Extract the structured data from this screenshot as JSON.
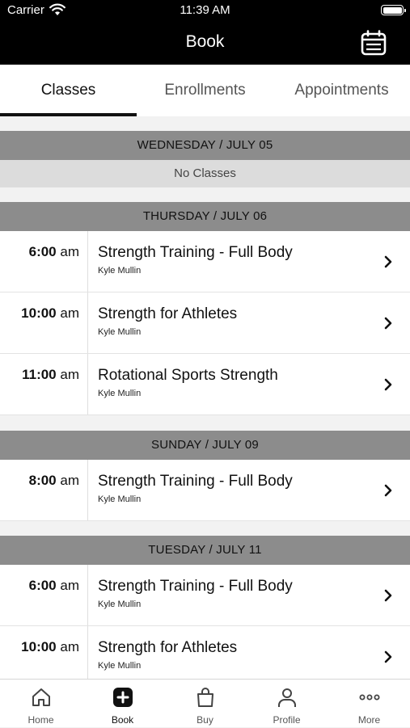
{
  "status_bar": {
    "carrier": "Carrier",
    "time": "11:39 AM"
  },
  "nav": {
    "title": "Book",
    "calendar_icon": "calendar-icon"
  },
  "tabs": [
    {
      "label": "Classes",
      "active": true
    },
    {
      "label": "Enrollments",
      "active": false
    },
    {
      "label": "Appointments",
      "active": false
    }
  ],
  "days": [
    {
      "header": "WEDNESDAY / JULY 05",
      "empty_text": "No Classes",
      "classes": []
    },
    {
      "header": "THURSDAY / JULY 06",
      "classes": [
        {
          "time": "6:00",
          "ampm": "am",
          "name": "Strength Training - Full Body",
          "instructor": "Kyle Mullin"
        },
        {
          "time": "10:00",
          "ampm": "am",
          "name": "Strength for Athletes",
          "instructor": "Kyle Mullin"
        },
        {
          "time": "11:00",
          "ampm": "am",
          "name": "Rotational Sports Strength",
          "instructor": "Kyle Mullin"
        }
      ]
    },
    {
      "header": "SUNDAY / JULY 09",
      "classes": [
        {
          "time": "8:00",
          "ampm": "am",
          "name": "Strength Training - Full Body",
          "instructor": "Kyle Mullin"
        }
      ]
    },
    {
      "header": "TUESDAY / JULY 11",
      "classes": [
        {
          "time": "6:00",
          "ampm": "am",
          "name": "Strength Training - Full Body",
          "instructor": "Kyle Mullin"
        },
        {
          "time": "10:00",
          "ampm": "am",
          "name": "Strength for Athletes",
          "instructor": "Kyle Mullin"
        }
      ]
    }
  ],
  "bottom_nav": [
    {
      "label": "Home",
      "icon": "home-icon",
      "active": false
    },
    {
      "label": "Book",
      "icon": "plus-square-icon",
      "active": true
    },
    {
      "label": "Buy",
      "icon": "shopping-bag-icon",
      "active": false
    },
    {
      "label": "Profile",
      "icon": "person-icon",
      "active": false
    },
    {
      "label": "More",
      "icon": "more-dots-icon",
      "active": false
    }
  ],
  "colors": {
    "nav_bg": "#000000",
    "section_header_bg": "#8c8c8c",
    "no_classes_bg": "#dcdcdc",
    "page_bg": "#f2f2f2"
  }
}
